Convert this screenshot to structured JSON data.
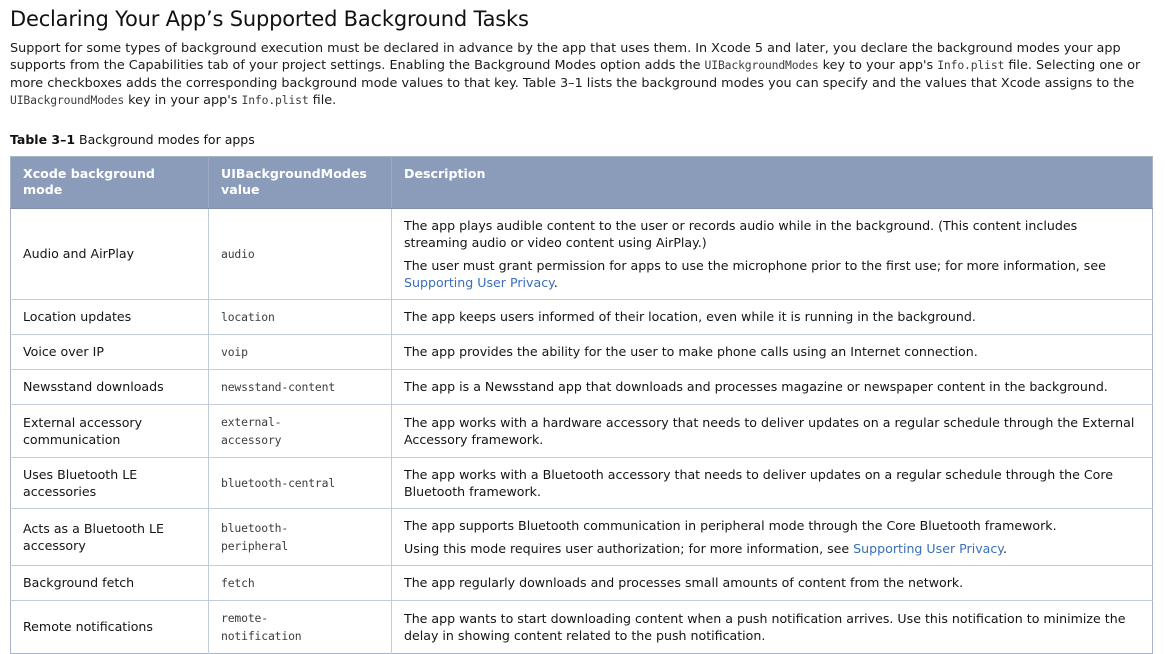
{
  "title": "Declaring Your App’s Supported Background Tasks",
  "intro": {
    "seg1": "Support for some types of background execution must be declared in advance by the app that uses them. In Xcode 5 and later, you declare the background modes your app supports from the Capabilities tab of your project settings. Enabling the Background Modes option adds the ",
    "code1": "UIBackgroundModes",
    "seg2": " key to your app's ",
    "code2": "Info.plist",
    "seg3": " file. Selecting one or more checkboxes adds the corresponding background mode values to that key. Table 3–1 lists the background modes you can specify and the values that Xcode assigns to the ",
    "code3": "UIBackgroundModes",
    "seg4": " key in your app's ",
    "code4": "Info.plist",
    "seg5": " file."
  },
  "table": {
    "caption_label": "Table 3–1",
    "caption_text": "Background modes for apps",
    "header_bg": "#8a9cba",
    "link_color": "#3a6fb8",
    "columns": [
      "Xcode background mode",
      "UIBackgroundModes value",
      "Description"
    ],
    "rows": [
      {
        "mode": "Audio and AirPlay",
        "value": "audio",
        "desc_paragraphs": [
          {
            "text": "The app plays audible content to the user or records audio while in the background. (This content includes streaming audio or video content using AirPlay.)"
          },
          {
            "pre": "The user must grant permission for apps to use the microphone prior to the first use; for more information, see ",
            "link": "Supporting User Privacy",
            "post": "."
          }
        ]
      },
      {
        "mode": "Location updates",
        "value": "location",
        "desc_paragraphs": [
          {
            "text": "The app keeps users informed of their location, even while it is running in the background."
          }
        ]
      },
      {
        "mode": "Voice over IP",
        "value": "voip",
        "desc_paragraphs": [
          {
            "text": "The app provides the ability for the user to make phone calls using an Internet connection."
          }
        ]
      },
      {
        "mode": "Newsstand downloads",
        "value": "newsstand-content",
        "desc_paragraphs": [
          {
            "text": "The app is a Newsstand app that downloads and processes magazine or newspaper content in the background."
          }
        ]
      },
      {
        "mode": "External accessory communication",
        "value": "external-\naccessory",
        "desc_paragraphs": [
          {
            "text": "The app works with a hardware accessory that needs to deliver updates on a regular schedule through the External Accessory framework."
          }
        ]
      },
      {
        "mode": "Uses Bluetooth LE accessories",
        "value": "bluetooth-central",
        "desc_paragraphs": [
          {
            "text": "The app works with a Bluetooth accessory that needs to deliver updates on a regular schedule through the Core Bluetooth framework."
          }
        ]
      },
      {
        "mode": "Acts as a Bluetooth LE accessory",
        "value": "bluetooth-\nperipheral",
        "desc_paragraphs": [
          {
            "text": "The app supports Bluetooth communication in peripheral mode through the Core Bluetooth framework."
          },
          {
            "pre": "Using this mode requires user authorization; for more information, see ",
            "link": "Supporting User Privacy",
            "post": "."
          }
        ]
      },
      {
        "mode": "Background fetch",
        "value": "fetch",
        "desc_paragraphs": [
          {
            "text": "The app regularly downloads and processes small amounts of content from the network."
          }
        ]
      },
      {
        "mode": "Remote notifications",
        "value": "remote-\nnotification",
        "desc_paragraphs": [
          {
            "text": "The app wants to start downloading content when a push notification arrives. Use this notification to minimize the delay in showing content related to the push notification."
          }
        ]
      }
    ]
  }
}
